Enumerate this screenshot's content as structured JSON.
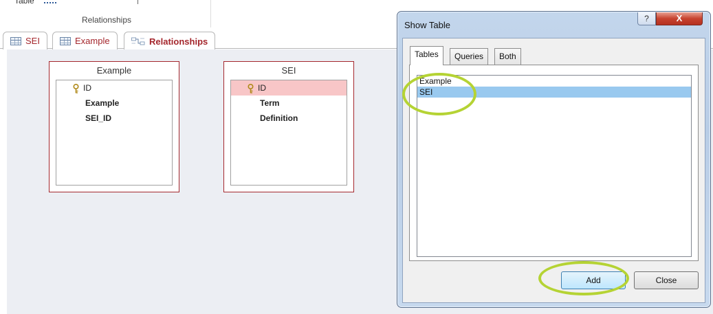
{
  "ribbon": {
    "cut_label": "Table",
    "group_label": "Relationships"
  },
  "doc_tabs": [
    {
      "label": "SEI",
      "icon": "table-icon"
    },
    {
      "label": "Example",
      "icon": "table-icon"
    },
    {
      "label": "Relationships",
      "icon": "relationships-icon",
      "active": true
    }
  ],
  "field_lists": {
    "example": {
      "title": "Example",
      "fields": [
        {
          "name": "ID",
          "primary_key": true
        },
        {
          "name": "Example"
        },
        {
          "name": "SEI_ID"
        }
      ]
    },
    "sei": {
      "title": "SEI",
      "fields": [
        {
          "name": "ID",
          "primary_key": true,
          "selected": true
        },
        {
          "name": "Term"
        },
        {
          "name": "Definition"
        }
      ]
    }
  },
  "dialog": {
    "title": "Show Table",
    "help_glyph": "?",
    "close_glyph": "X",
    "tabs": [
      "Tables",
      "Queries",
      "Both"
    ],
    "active_tab": "Tables",
    "list_items": [
      "Example",
      "SEI"
    ],
    "selected_item": "SEI",
    "add_label": "Add",
    "close_label": "Close"
  },
  "colors": {
    "accent": "#a4262c",
    "selection": "#99c9ef",
    "pk_selection": "#f8c6c7",
    "annotation": "#b5d334"
  }
}
